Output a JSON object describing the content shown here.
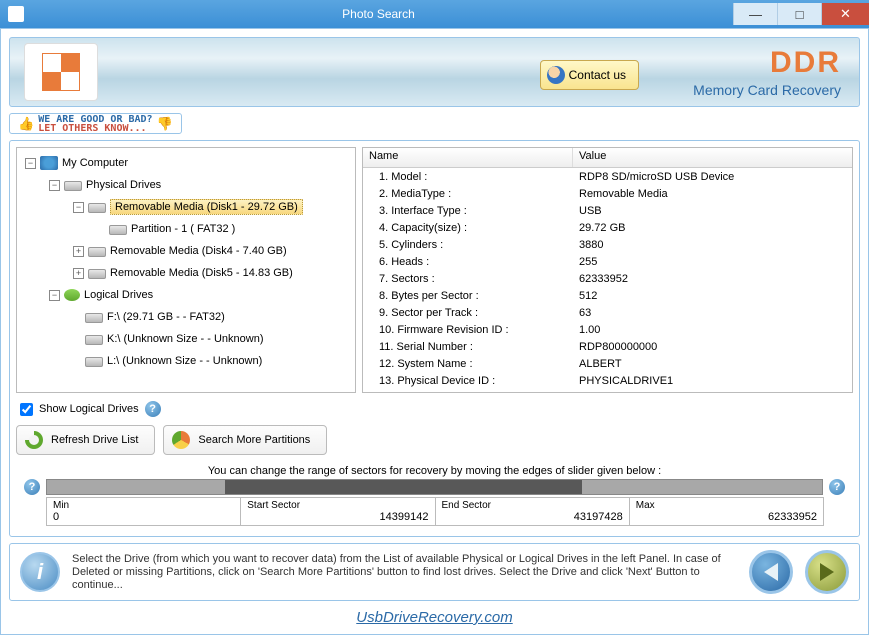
{
  "window": {
    "title": "Photo Search"
  },
  "banner": {
    "contact_label": "Contact us",
    "brand": "DDR",
    "tagline": "Memory Card Recovery"
  },
  "feedback": {
    "line1": "WE ARE GOOD OR BAD?",
    "line2": "LET OTHERS KNOW..."
  },
  "tree": {
    "root": "My Computer",
    "physical": "Physical Drives",
    "disk1": "Removable Media (Disk1 - 29.72 GB)",
    "disk1_part": "Partition - 1 ( FAT32 )",
    "disk4": "Removable Media (Disk4 - 7.40 GB)",
    "disk5": "Removable Media (Disk5 - 14.83 GB)",
    "logical": "Logical Drives",
    "f": "F:\\ (29.71 GB  -  - FAT32)",
    "k": "K:\\ (Unknown Size  -  - Unknown)",
    "l": "L:\\ (Unknown Size  -  - Unknown)"
  },
  "props_header": {
    "name": "Name",
    "value": "Value"
  },
  "props": [
    {
      "n": "1. Model :",
      "v": "RDP8 SD/microSD USB Device"
    },
    {
      "n": "2. MediaType :",
      "v": "Removable Media"
    },
    {
      "n": "3. Interface Type :",
      "v": "USB"
    },
    {
      "n": "4. Capacity(size) :",
      "v": "29.72 GB"
    },
    {
      "n": "5. Cylinders :",
      "v": "3880"
    },
    {
      "n": "6. Heads :",
      "v": "255"
    },
    {
      "n": "7. Sectors :",
      "v": "62333952"
    },
    {
      "n": "8. Bytes per Sector :",
      "v": "512"
    },
    {
      "n": "9. Sector per Track :",
      "v": "63"
    },
    {
      "n": "10. Firmware Revision ID :",
      "v": "1.00"
    },
    {
      "n": "11. Serial Number :",
      "v": "RDP800000000"
    },
    {
      "n": "12. System Name :",
      "v": "ALBERT"
    },
    {
      "n": "13. Physical Device ID :",
      "v": "PHYSICALDRIVE1"
    }
  ],
  "show_logical_label": "Show Logical Drives",
  "buttons": {
    "refresh": "Refresh Drive List",
    "search_more": "Search More Partitions"
  },
  "slider": {
    "instruction": "You can change the range of sectors for recovery by moving the edges of slider given below :",
    "min_label": "Min",
    "min_val": "0",
    "start_label": "Start Sector",
    "start_val": "14399142",
    "end_label": "End Sector",
    "end_val": "43197428",
    "max_label": "Max",
    "max_val": "62333952"
  },
  "footer_text": "Select the Drive (from which you want to recover data) from the List of available Physical or Logical Drives in the left Panel. In case of Deleted or missing Partitions, click on 'Search More Partitions' button to find lost drives. Select the Drive and click 'Next' Button to continue...",
  "watermark": "UsbDriveRecovery.com"
}
